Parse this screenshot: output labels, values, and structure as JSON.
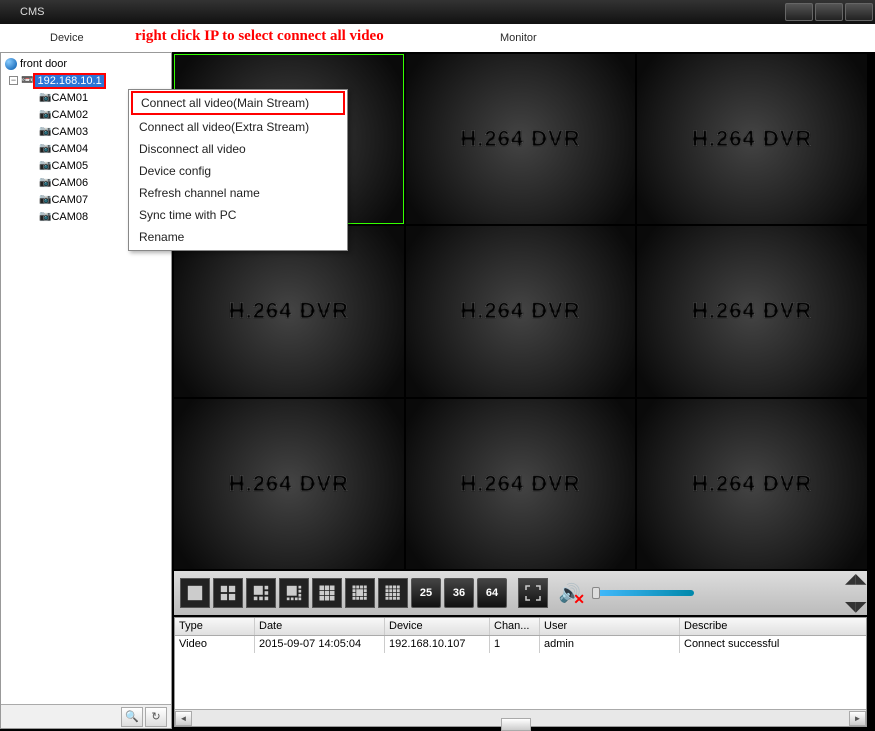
{
  "title": "CMS",
  "menu": {
    "device": "Device",
    "monitor": "Monitor"
  },
  "annotation": "right click IP to select connect all video",
  "tree": {
    "root": "front door",
    "ip": "192.168.10.1",
    "cams": [
      "CAM01",
      "CAM02",
      "CAM03",
      "CAM04",
      "CAM05",
      "CAM06",
      "CAM07",
      "CAM08"
    ]
  },
  "context_menu": [
    "Connect all video(Main Stream)",
    "Connect all video(Extra Stream)",
    "Disconnect all video",
    "Device config",
    "Refresh channel name",
    "Sync time with PC",
    "Rename"
  ],
  "watermark": "H.264 DVR",
  "layout_numbers": [
    "25",
    "36",
    "64"
  ],
  "log": {
    "headers": {
      "type": "Type",
      "date": "Date",
      "device": "Device",
      "chan": "Chan...",
      "user": "User",
      "desc": "Describe"
    },
    "rows": [
      {
        "type": "Video",
        "date": "2015-09-07 14:05:04",
        "device": "192.168.10.107",
        "chan": "1",
        "user": "admin",
        "desc": "Connect successful"
      }
    ]
  }
}
